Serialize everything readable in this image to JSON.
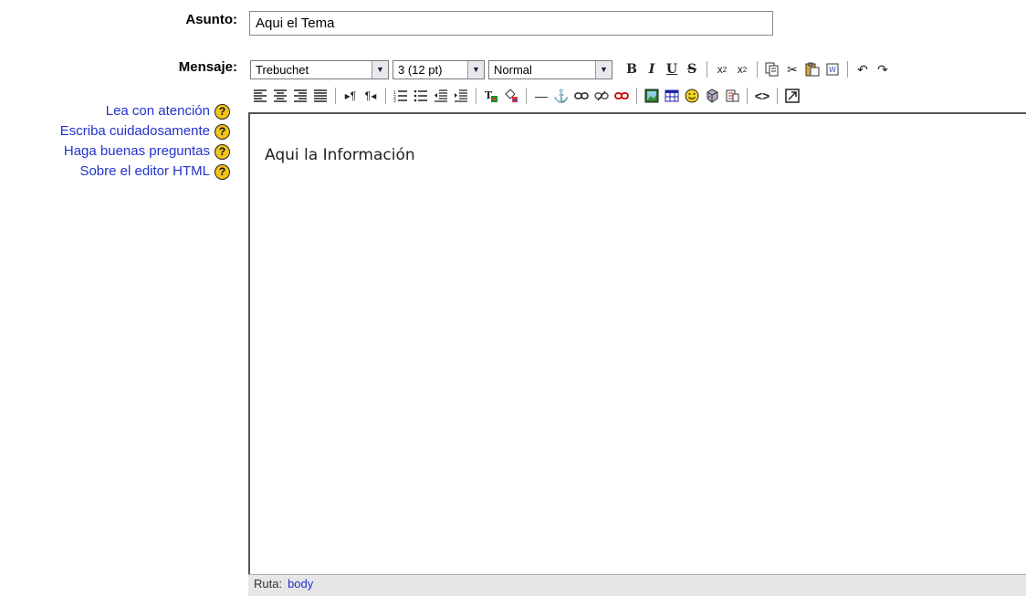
{
  "form": {
    "subject_label": "Asunto:",
    "subject_value": "Aqui el Tema",
    "message_label": "Mensaje:"
  },
  "help_links": [
    {
      "label": "Lea con atención",
      "icon": "help-icon"
    },
    {
      "label": "Escriba cuidadosamente",
      "icon": "help-icon"
    },
    {
      "label": "Haga buenas preguntas",
      "icon": "help-icon"
    },
    {
      "label": "Sobre el editor HTML",
      "icon": "help-icon"
    }
  ],
  "help_icon_glyph": "?",
  "toolbar": {
    "font_value": "Trebuchet",
    "size_value": "3 (12 pt)",
    "format_value": "Normal",
    "dropdown_arrow": "▼"
  },
  "editor": {
    "content": "Aqui la Información"
  },
  "statusbar": {
    "label": "Ruta:",
    "path": "body"
  },
  "colors": {
    "link": "#2233cc",
    "help_icon": "#f3c31a",
    "statusbar_bg": "#e6e6e6"
  }
}
